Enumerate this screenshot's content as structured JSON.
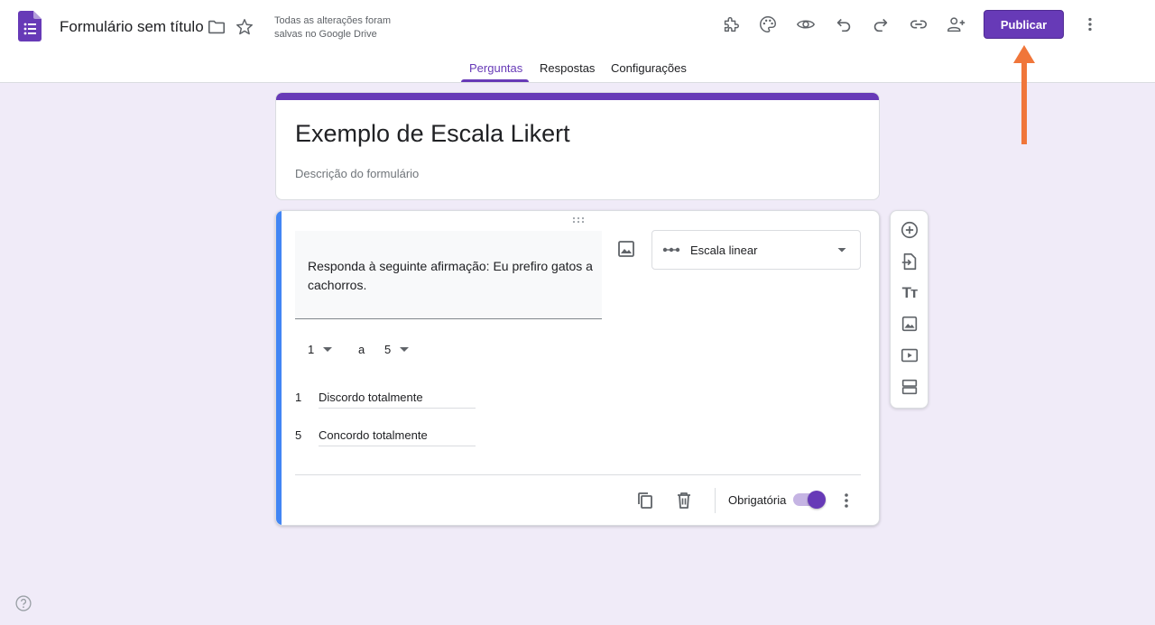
{
  "header": {
    "doc_title": "Formulário sem título",
    "save_status": "Todas as alterações foram salvas no Google Drive",
    "publish_label": "Publicar",
    "icons": [
      "forms-logo-icon",
      "folder-icon",
      "star-icon",
      "addon-puzzle-icon",
      "palette-icon",
      "preview-eye-icon",
      "undo-icon",
      "redo-icon",
      "link-icon",
      "add-collaborator-icon",
      "more-vert-icon"
    ]
  },
  "tabs": [
    {
      "label": "Perguntas",
      "active": true
    },
    {
      "label": "Respostas",
      "active": false
    },
    {
      "label": "Configurações",
      "active": false
    }
  ],
  "form": {
    "title": "Exemplo de Escala Likert",
    "description_placeholder": "Descrição do formulário"
  },
  "question": {
    "text": "Responda à seguinte afirmação: Eu prefiro gatos a cachorros.",
    "type_label": "Escala linear",
    "range": {
      "min": "1",
      "separator": "a",
      "max": "5"
    },
    "labels": [
      {
        "num": "1",
        "text": "Discordo totalmente"
      },
      {
        "num": "5",
        "text": "Concordo totalmente"
      }
    ],
    "required_label": "Obrigatória",
    "required": true
  },
  "side_toolbar": {
    "items": [
      "add-question-icon",
      "import-questions-icon",
      "add-title-icon",
      "add-image-icon",
      "add-video-icon",
      "add-section-icon"
    ],
    "title_glyph": "Tт"
  },
  "colors": {
    "accent": "#673ab7",
    "background": "#f0ebf8",
    "question_accent": "#4285f4",
    "arrow": "#f0763a"
  }
}
